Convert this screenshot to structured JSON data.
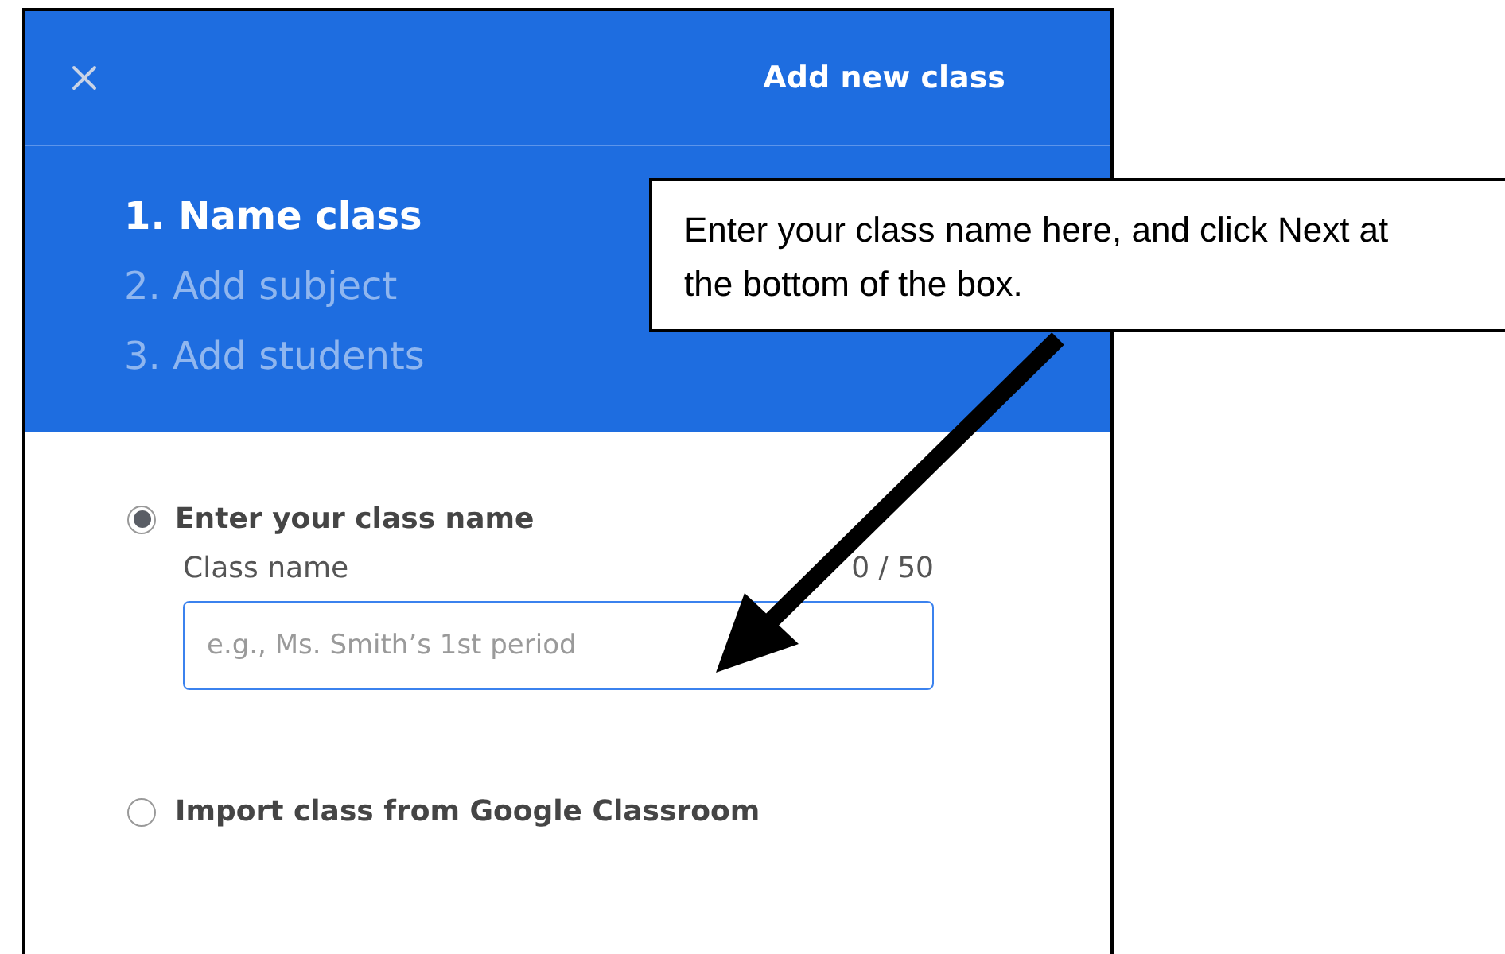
{
  "dialog": {
    "title": "Add new class"
  },
  "steps": [
    {
      "label": "1. Name class",
      "selected": true
    },
    {
      "label": "2. Add subject",
      "selected": false
    },
    {
      "label": "3. Add students",
      "selected": false
    }
  ],
  "options": [
    {
      "label": "Enter your class name",
      "selected": true,
      "field": {
        "label": "Class name",
        "counter": "0 / 50",
        "placeholder": "e.g., Ms. Smith’s 1st period"
      }
    },
    {
      "label": "Import class from Google Classroom",
      "selected": false
    }
  ],
  "annotation": {
    "text": "Enter your class name here, and click Next at the bottom of the box."
  }
}
